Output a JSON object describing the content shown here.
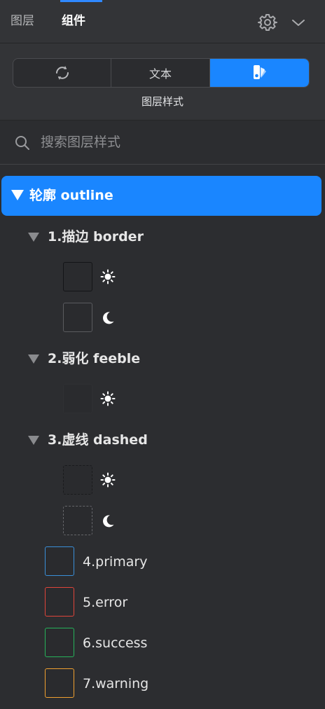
{
  "header": {
    "tabs": [
      {
        "label": "图层",
        "active": false
      },
      {
        "label": "组件",
        "active": true
      }
    ],
    "icons": [
      "gear-icon",
      "chevron-down-icon"
    ]
  },
  "segmented": {
    "options": [
      {
        "icon": "sync-icon",
        "label": ""
      },
      {
        "label": "文本"
      },
      {
        "icon": "layer-style-icon",
        "label": "",
        "active": true
      }
    ],
    "caption": "图层样式"
  },
  "search": {
    "placeholder": "搜索图层样式",
    "value": ""
  },
  "tree": {
    "root": {
      "label": "轮廓 outline",
      "expanded": true
    },
    "groups": [
      {
        "label": "1.描边 border",
        "expanded": true,
        "items": [
          "sun-icon",
          "moon-icon"
        ]
      },
      {
        "label": "2.弱化 feeble",
        "expanded": true,
        "items": [
          "sun-icon"
        ]
      },
      {
        "label": "3.虚线 dashed",
        "expanded": true,
        "items": [
          "sun-icon",
          "moon-icon"
        ]
      }
    ],
    "color_items": [
      {
        "label": "4.primary",
        "color": "#3a8fd9"
      },
      {
        "label": "5.error",
        "color": "#e0453a"
      },
      {
        "label": "6.success",
        "color": "#26b35a"
      },
      {
        "label": "7.warning",
        "color": "#f0a030"
      }
    ]
  },
  "colors": {
    "accent": "#1a86ff",
    "background": "#2c2d30",
    "panel": "#333437"
  }
}
